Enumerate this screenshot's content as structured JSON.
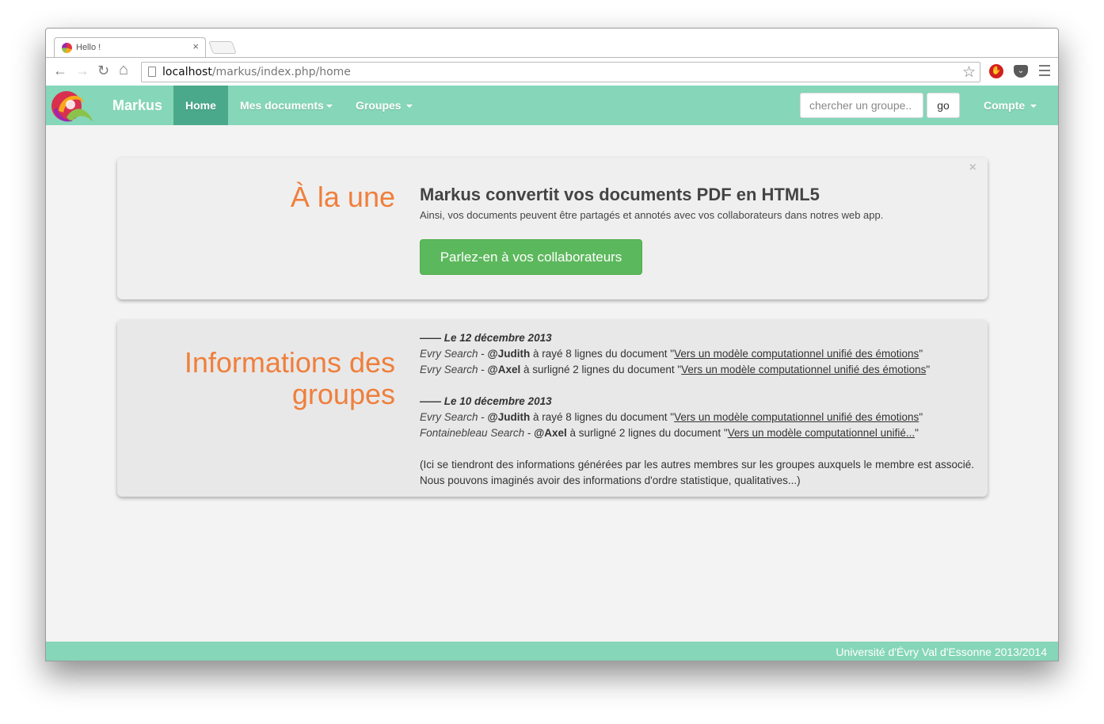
{
  "browser": {
    "tab_title": "Hello !",
    "tab_close": "×",
    "url_host": "localhost",
    "url_path": "/markus/index.php/home",
    "back_glyph": "←",
    "forward_glyph": "→",
    "reload_glyph": "↻",
    "home_glyph": "⌂",
    "star_glyph": "☆",
    "icons": [
      "back-icon",
      "forward-icon",
      "reload-icon",
      "home-icon",
      "page-icon",
      "star-icon",
      "stop-extension-icon",
      "pocket-icon",
      "menu-icon"
    ]
  },
  "navbar": {
    "brand": "Markus",
    "home": "Home",
    "documents": "Mes documents",
    "groups": "Groupes",
    "search_placeholder": "chercher un groupe..",
    "go": "go",
    "account": "Compte",
    "accent_color": "#86d6b9",
    "active_color": "#4aa98a"
  },
  "featured": {
    "heading": "À la une",
    "close": "×",
    "title": "Markus convertit vos documents PDF en HTML5",
    "text": "Ainsi, vos documents peuvent être partagés et annotés avec vos collaborateurs dans notres web app.",
    "button": "Parlez-en à vos collaborateurs",
    "button_color": "#5cb85c",
    "heading_color": "#ef7f3c"
  },
  "groups_info": {
    "heading_line1": "Informations des",
    "heading_line2": "groupes",
    "days": [
      {
        "date": "—— Le 12 décembre 2013",
        "entries": [
          {
            "group": "Evry Search",
            "sep": " - ",
            "user": "@Judith",
            "action": " à rayé 8 lignes du document \"",
            "doc": "Vers un modèle computationnel unifié des émotions",
            "end": "\""
          },
          {
            "group": "Evry Search",
            "sep": " - ",
            "user": "@Axel",
            "action": " à surligné 2 lignes du document \"",
            "doc": "Vers un modèle computationnel unifié des émotions",
            "end": "\""
          }
        ]
      },
      {
        "date": "—— Le 10 décembre 2013",
        "entries": [
          {
            "group": "Evry Search",
            "sep": " - ",
            "user": "@Judith",
            "action": " à rayé 8 lignes du document \"",
            "doc": "Vers un modèle computationnel unifié des émotions",
            "end": "\""
          },
          {
            "group": "Fontainebleau Search",
            "sep": " - ",
            "user": "@Axel",
            "action": " à surligné 2 lignes du document \"",
            "doc": "Vers un modèle computationnel unifié...",
            "end": "\""
          }
        ]
      }
    ],
    "note": "(Ici se tiendront des informations générées par les autres membres sur les groupes auxquels le membre est associé. Nous pouvons imaginés avoir des informations d'ordre statistique, qualitatives...)"
  },
  "footer": {
    "text": "Université d'Évry Val d'Essonne 2013/2014"
  }
}
